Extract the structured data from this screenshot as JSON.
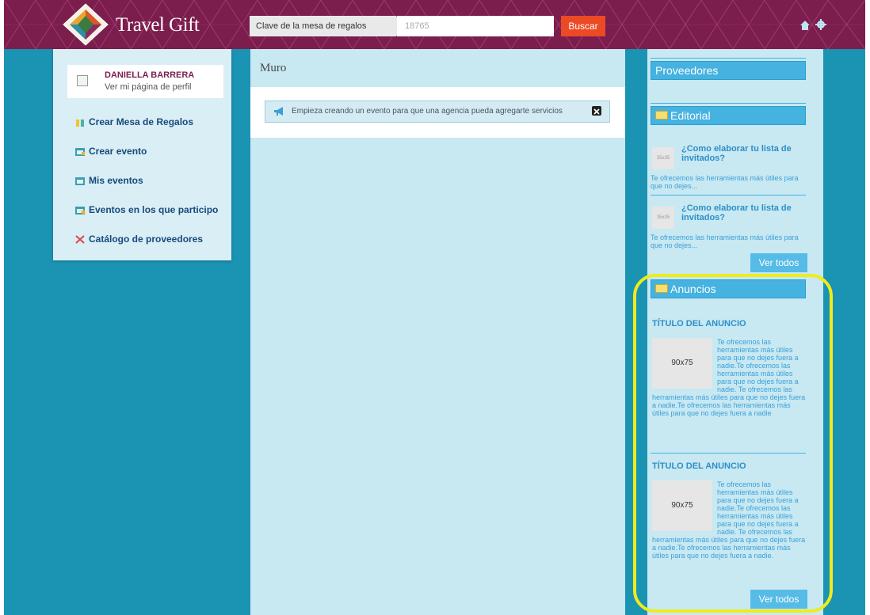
{
  "header": {
    "brand": "Travel Gift",
    "search_label": "Clave de la mesa de regalos",
    "search_value": "18765",
    "search_button": "Buscar"
  },
  "profile": {
    "name": "DANIELLA BARRERA",
    "link": "Ver mi página de perfil"
  },
  "nav": [
    {
      "label": "Crear Mesa de Regalos",
      "icon": "gift-table-icon"
    },
    {
      "label": "Crear evento",
      "icon": "create-event-icon"
    },
    {
      "label": "Mis eventos",
      "icon": "my-events-icon"
    },
    {
      "label": "Eventos en los que participo",
      "icon": "participating-events-icon"
    },
    {
      "label": "Catálogo de proveedores",
      "icon": "suppliers-catalog-icon"
    }
  ],
  "main": {
    "title": "Muro",
    "notice": "Empieza creando un evento para que una agencia pueda agregarte servicios"
  },
  "right": {
    "proveedores_title": "Proveedores",
    "editorial_title": "Editorial",
    "editorial_items": [
      {
        "thumb": "35x35",
        "title": "¿Como elaborar tu lista de invitados?",
        "desc": "Te ofrecemos las herramientas más útiles para que no dejes..."
      },
      {
        "thumb": "35x35",
        "title": "¿Como elaborar tu lista de invitados?",
        "desc": "Te ofrecemos las herramientas más útiles para que no dejes..."
      }
    ],
    "ver_todos": "Ver todos",
    "anuncios_title": "Anuncios",
    "ads": [
      {
        "title": "TÍTULO DEL ANUNCIO",
        "thumb": "90x75",
        "text": "Te ofrecemos las herramientas más útiles para que no dejes fuera a nadie.Te ofrecemos las herramientas más útiles para que no dejes fuera a nadie. Te ofrecemos las herramientas más útiles para que no dejes fuera a nadie.Te ofrecemos las herramientas más útiles para que no dejes fuera a nadie"
      },
      {
        "title": "TÍTULO DEL ANUNCIO",
        "thumb": "90x75",
        "text": "Te ofrecemos las herramientas más útiles para que no dejes fuera a nadie.Te ofrecemos las herramientas más útiles para que no dejes fuera a nadie. Te ofrecemos las herramientas más útiles para que no dejes fuera a nadie.Te ofrecemos las herramientas más útiles para que no dejes fuera a nadie."
      }
    ],
    "ver_todos_ads": "Ver todos"
  },
  "colors": {
    "header_bg": "#7b1d4d",
    "page_bg": "#1b93b2",
    "panel_bg": "#c8e8f2",
    "accent_blue": "#45b2e0",
    "search_button": "#ec4a25",
    "highlight": "#f0ec1a"
  }
}
